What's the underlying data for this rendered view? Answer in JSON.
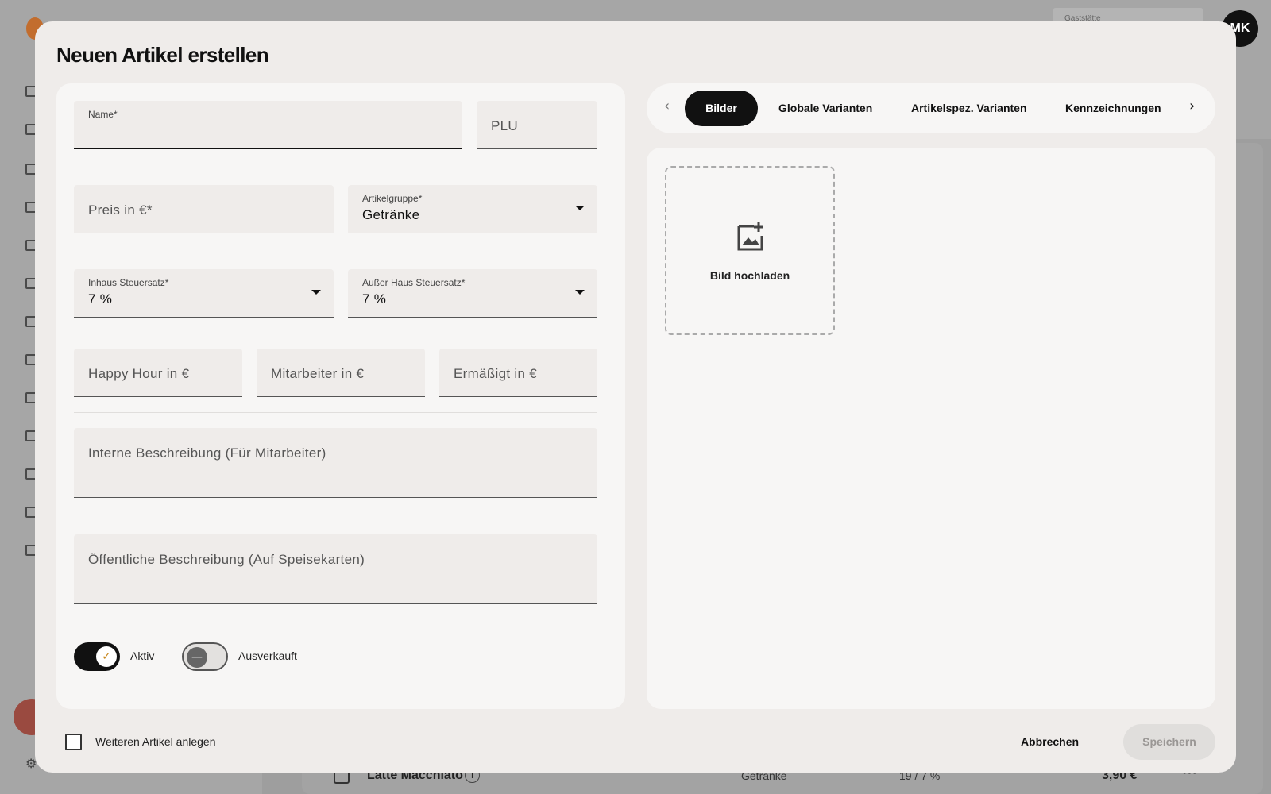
{
  "background": {
    "top_selector_label": "Gaststätte",
    "avatar_initials": "MK",
    "row": {
      "name": "Latte Macchiato",
      "group": "Getränke",
      "tax": "19 / 7 %",
      "price": "3,90 €",
      "more": "•••"
    }
  },
  "modal": {
    "title": "Neuen Artikel erstellen",
    "fields": {
      "name": {
        "label": "Name*",
        "value": ""
      },
      "plu": {
        "placeholder": "PLU"
      },
      "price": {
        "placeholder": "Preis in €*"
      },
      "group": {
        "label": "Artikelgruppe*",
        "value": "Getränke"
      },
      "tax_in": {
        "label": "Inhaus Steuersatz*",
        "value": "7 %"
      },
      "tax_out": {
        "label": "Außer Haus Steuersatz*",
        "value": "7 %"
      },
      "happy_hour": {
        "placeholder": "Happy Hour in €"
      },
      "staff": {
        "placeholder": "Mitarbeiter in €"
      },
      "reduced": {
        "placeholder": "Ermäßigt in €"
      },
      "internal_desc": {
        "placeholder": "Interne Beschreibung (Für Mitarbeiter)"
      },
      "public_desc": {
        "placeholder": "Öffentliche Beschreibung (Auf Speisekarten)"
      }
    },
    "toggles": {
      "active": {
        "label": "Aktiv",
        "on": true,
        "glyph": "✓"
      },
      "sold_out": {
        "label": "Ausverkauft",
        "on": false,
        "glyph": "—"
      }
    },
    "tabs": [
      "Bilder",
      "Globale Varianten",
      "Artikelspez. Varianten",
      "Kennzeichnungen"
    ],
    "active_tab": "Bilder",
    "tab_prev_glyph": "‹",
    "tab_next_glyph": "›",
    "upload_label": "Bild hochladen",
    "footer": {
      "checkbox_label": "Weiteren Artikel anlegen",
      "checkbox_checked": false,
      "cancel_label": "Abbrechen",
      "save_label": "Speichern"
    }
  },
  "icons": {
    "upload": "image-plus-icon",
    "gear": "gear-icon"
  }
}
